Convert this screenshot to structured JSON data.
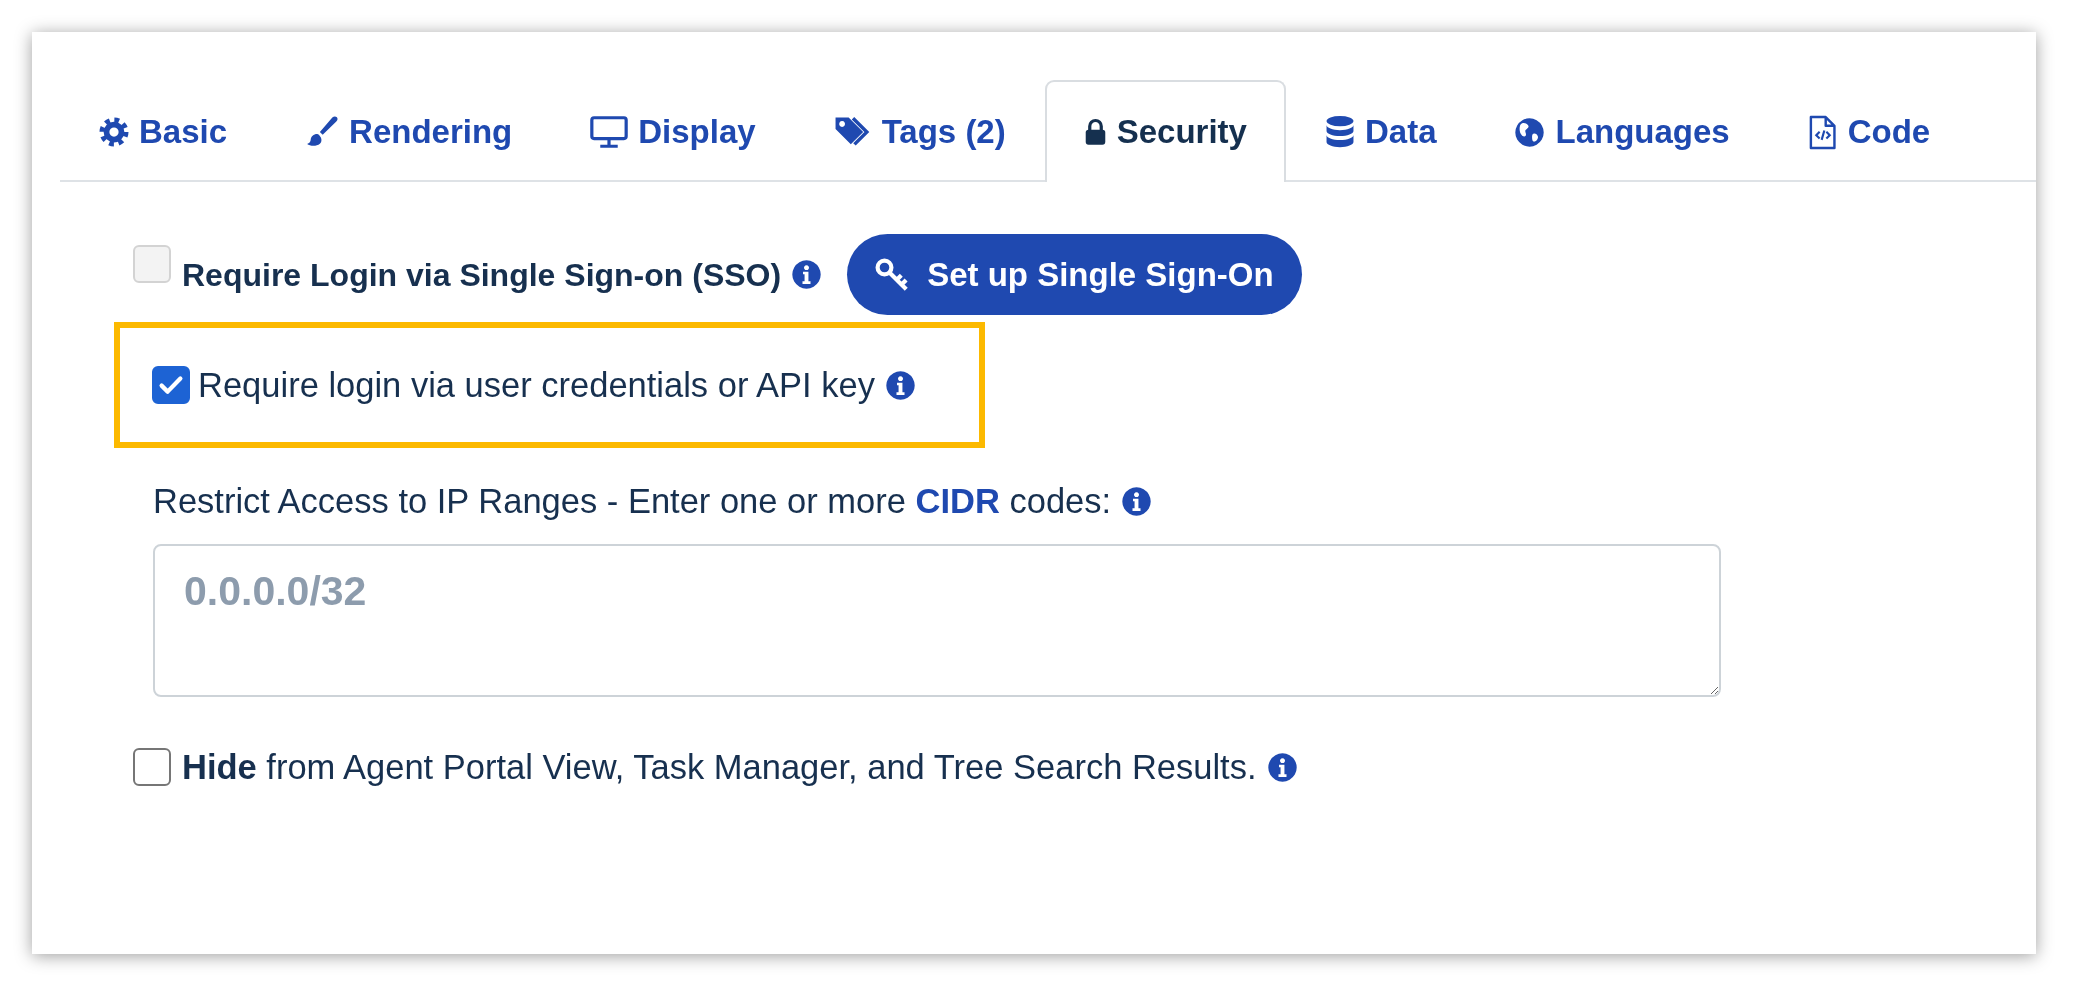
{
  "tabs": [
    {
      "label": "Basic",
      "selected": false
    },
    {
      "label": "Rendering",
      "selected": false
    },
    {
      "label": "Display",
      "selected": false
    },
    {
      "label": "Tags (2)",
      "selected": false
    },
    {
      "label": "Security",
      "selected": true
    },
    {
      "label": "Data",
      "selected": false
    },
    {
      "label": "Languages",
      "selected": false
    },
    {
      "label": "Code",
      "selected": false
    }
  ],
  "security": {
    "sso": {
      "label": "Require Login via Single Sign-on (SSO)",
      "checked": false,
      "disabled": true,
      "button": "Set up Single Sign-On"
    },
    "login": {
      "label": "Require login via user credentials or API key",
      "checked": true,
      "disabled": false,
      "highlighted": true
    },
    "ip_ranges": {
      "label": "Restrict Access to IP Ranges - Enter one or more",
      "link": "CIDR",
      "label_end": "codes:",
      "placeholder": "0.0.0.0/32"
    },
    "hide": {
      "label": "**Hide** from Agent Portal View, Task Manager, and Tree Search Results.",
      "checked": false,
      "disabled": false
    }
  }
}
